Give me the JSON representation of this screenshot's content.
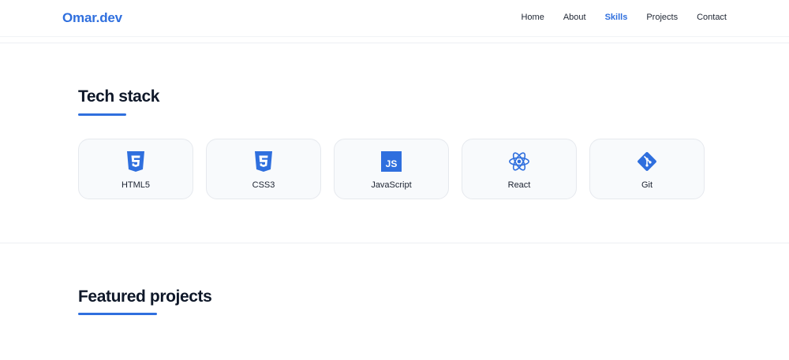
{
  "header": {
    "logo": "Omar.dev",
    "nav": [
      {
        "label": "Home"
      },
      {
        "label": "About"
      },
      {
        "label": "Skills",
        "active": true
      },
      {
        "label": "Projects"
      },
      {
        "label": "Contact"
      }
    ]
  },
  "tech_stack": {
    "title": "Tech stack",
    "items": [
      {
        "label": "HTML5",
        "icon": "html5-icon"
      },
      {
        "label": "CSS3",
        "icon": "css3-icon"
      },
      {
        "label": "JavaScript",
        "icon": "javascript-icon"
      },
      {
        "label": "React",
        "icon": "react-icon"
      },
      {
        "label": "Git",
        "icon": "git-icon"
      }
    ]
  },
  "projects": {
    "title": "Featured projects"
  },
  "colors": {
    "accent": "#2f6fde",
    "text": "#0f1829",
    "card_bg": "#f8fafc",
    "card_border": "#e6e9ee"
  }
}
